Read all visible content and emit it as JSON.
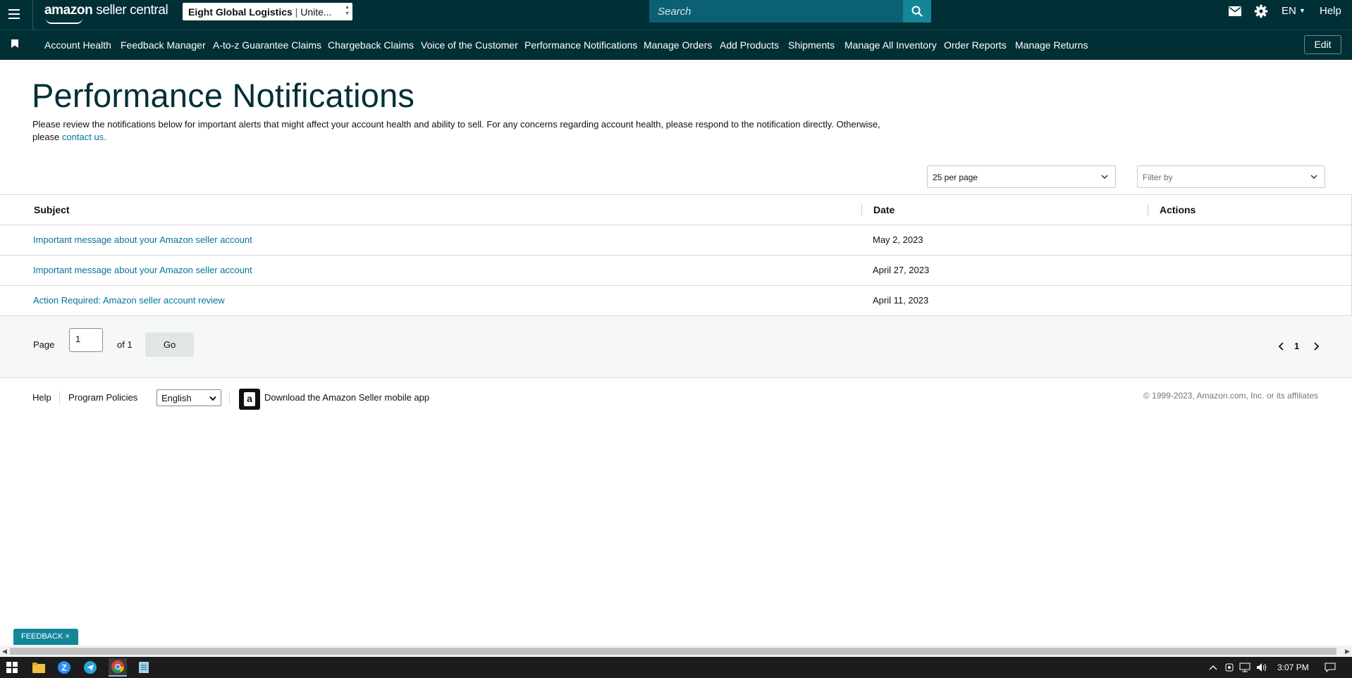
{
  "header": {
    "logo_bold": "amazon",
    "logo_rest": " seller central",
    "store_name": "Eight Global Logistics",
    "store_divider": " | ",
    "store_region": "Unite...",
    "search_placeholder": "Search",
    "language": "EN",
    "help": "Help"
  },
  "nav": {
    "items": [
      "Account Health",
      "Feedback Manager",
      "A-to-z Guarantee Claims",
      "Chargeback Claims",
      "Voice of the Customer",
      "Performance Notifications",
      "Manage Orders",
      "Add Products",
      "Shipments",
      "Manage All Inventory",
      "Order Reports",
      "Manage Returns"
    ],
    "edit": "Edit"
  },
  "page": {
    "title": "Performance Notifications",
    "intro": "Please review the notifications below for important alerts that might affect your account health and ability to sell. For any concerns regarding account health, please respond to the notification directly. Otherwise, please ",
    "contact_link": "contact us.",
    "per_page": "25 per page",
    "filter_placeholder": "Filter by"
  },
  "table": {
    "headers": {
      "subject": "Subject",
      "date": "Date",
      "actions": "Actions"
    },
    "rows": [
      {
        "subject": "Important message about your Amazon seller account",
        "date": "May 2, 2023"
      },
      {
        "subject": "Important message about your Amazon seller account",
        "date": "April 27, 2023"
      },
      {
        "subject": "Action Required: Amazon seller account review",
        "date": "April 11, 2023"
      }
    ]
  },
  "pager": {
    "page_label": "Page",
    "page_value": "1",
    "of_label": "of 1",
    "go": "Go",
    "current_page": "1"
  },
  "footer": {
    "help": "Help",
    "policies": "Program Policies",
    "language": "English",
    "app_link": "Download the Amazon Seller mobile app",
    "copyright": "© 1999-2023, Amazon.com, Inc. or its affiliates"
  },
  "feedback_tab": "FEEDBACK ×",
  "taskbar": {
    "time": "3:07 PM"
  },
  "colors": {
    "header_bg": "#002f36",
    "search_bg": "#0b6172",
    "search_btn": "#14869a",
    "link": "#00749b"
  }
}
